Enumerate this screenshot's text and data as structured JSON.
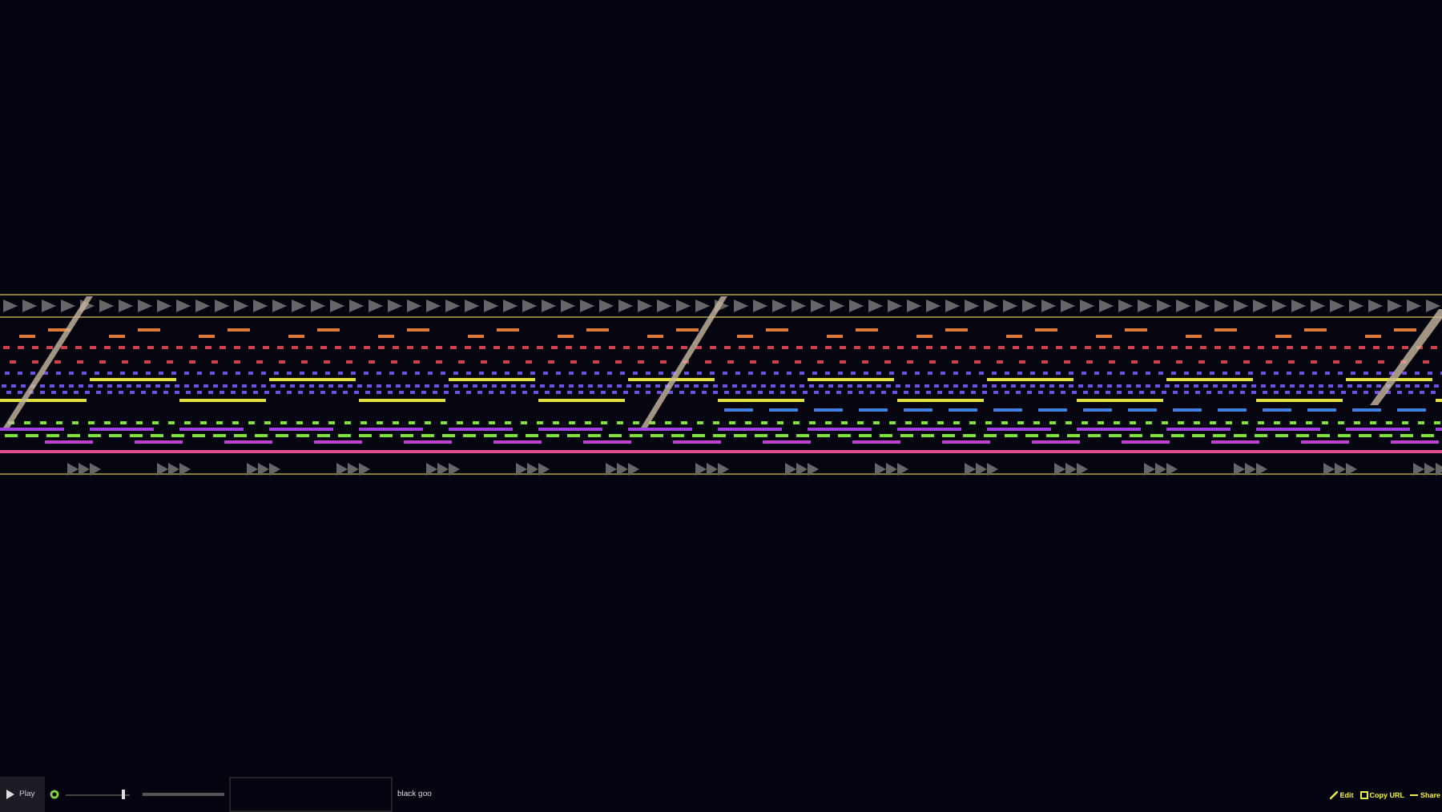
{
  "player": {
    "play_button": "Play",
    "volume": {
      "level": 0.9
    },
    "song_title": "black goo"
  },
  "links": [
    {
      "label": "Edit",
      "kind": "edit"
    },
    {
      "label": "Copy URL",
      "kind": "copy"
    },
    {
      "label": "Share",
      "kind": "share"
    }
  ]
}
